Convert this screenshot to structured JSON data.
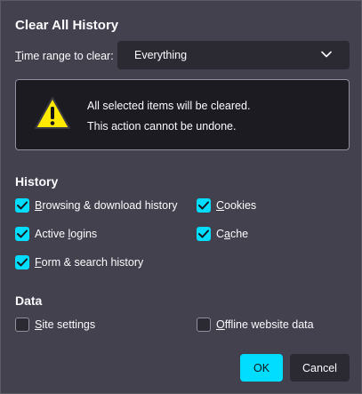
{
  "dialog": {
    "title": "Clear All History"
  },
  "time_range": {
    "label_prefix": "",
    "label_accesskey": "T",
    "label_rest": "ime range to clear:",
    "selected": "Everything"
  },
  "warning": {
    "line1": "All selected items will be cleared.",
    "line2": "This action cannot be undone."
  },
  "history": {
    "title": "History",
    "items": [
      {
        "pre": "",
        "key": "B",
        "post": "rowsing & download history",
        "checked": true
      },
      {
        "pre": "",
        "key": "C",
        "post": "ookies",
        "checked": true
      },
      {
        "pre": "Active ",
        "key": "l",
        "post": "ogins",
        "checked": true
      },
      {
        "pre": "C",
        "key": "a",
        "post": "che",
        "checked": true
      },
      {
        "pre": "",
        "key": "F",
        "post": "orm & search history",
        "checked": true
      }
    ]
  },
  "data": {
    "title": "Data",
    "items": [
      {
        "pre": "",
        "key": "S",
        "post": "ite settings",
        "checked": false
      },
      {
        "pre": "",
        "key": "O",
        "post": "ffline website data",
        "checked": false
      }
    ]
  },
  "buttons": {
    "ok": "OK",
    "cancel": "Cancel"
  },
  "colors": {
    "accent": "#00ddff",
    "dialog_bg": "#42414d",
    "field_bg": "#2b2a33",
    "warning_icon": "#ffe900"
  }
}
